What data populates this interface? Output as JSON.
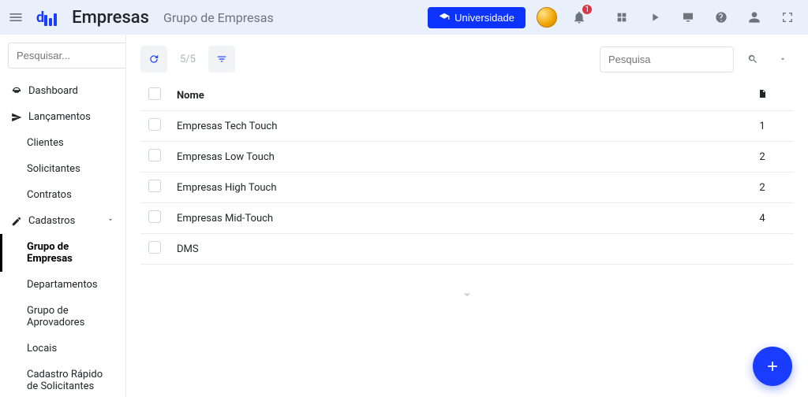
{
  "header": {
    "title": "Empresas",
    "subtitle": "Grupo de Empresas",
    "university_label": "Universidade",
    "notification_count": "1"
  },
  "sidebar": {
    "search_placeholder": "Pesquisar...",
    "dashboard": "Dashboard",
    "lancamentos": "Lançamentos",
    "clientes": "Clientes",
    "solicitantes": "Solicitantes",
    "contratos": "Contratos",
    "cadastros": "Cadastros",
    "grupo_empresas": "Grupo de Empresas",
    "departamentos": "Departamentos",
    "grupo_aprovadores": "Grupo de Aprovadores",
    "locais": "Locais",
    "cadastro_rapido": "Cadastro Rápido de Solicitantes"
  },
  "toolbar": {
    "count": "5/5",
    "search_placeholder": "Pesquisa"
  },
  "table": {
    "header_name": "Nome",
    "rows": [
      {
        "name": "Empresas Tech Touch",
        "count": "1"
      },
      {
        "name": "Empresas Low Touch",
        "count": "2"
      },
      {
        "name": "Empresas High Touch",
        "count": "2"
      },
      {
        "name": "Empresas Mid-Touch",
        "count": "4"
      },
      {
        "name": "DMS",
        "count": ""
      }
    ]
  }
}
